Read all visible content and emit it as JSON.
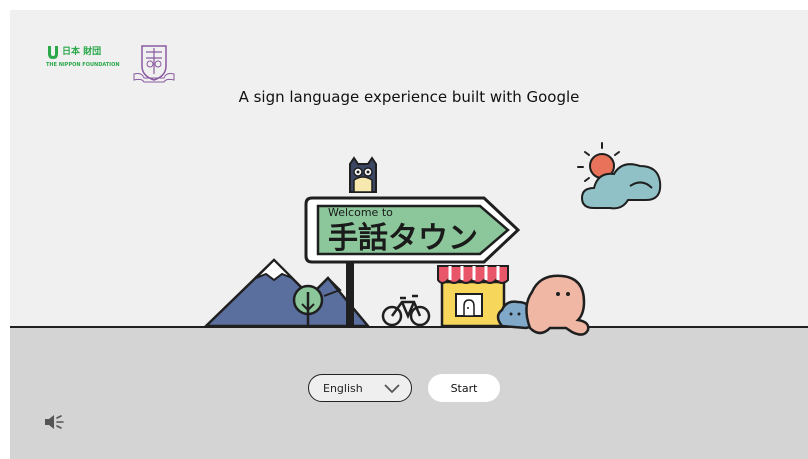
{
  "logos": {
    "nippon_foundation_text": "THE NIPPON FOUNDATION",
    "nippon_foundation_jp": "日本 財団"
  },
  "headline": "A sign language experience built with Google",
  "signboard": {
    "small_text": "Welcome to",
    "big_text": "手話タウン"
  },
  "controls": {
    "language_selected": "English",
    "start_label": "Start"
  },
  "icons": {
    "language_dropdown": "chevron-down-icon",
    "sound": "speaker-icon"
  },
  "colors": {
    "background": "#f0f0f0",
    "ground": "#d4d4d4",
    "sign_green": "#8bc79a",
    "mountain_blue": "#5a6f9e",
    "cloud_teal": "#8fc1c6",
    "sun_orange": "#e8735a",
    "character_pink": "#f0b7a4",
    "shop_yellow": "#f7d65c",
    "awning_red": "#e8566a",
    "nippon_green": "#2aa84a"
  }
}
